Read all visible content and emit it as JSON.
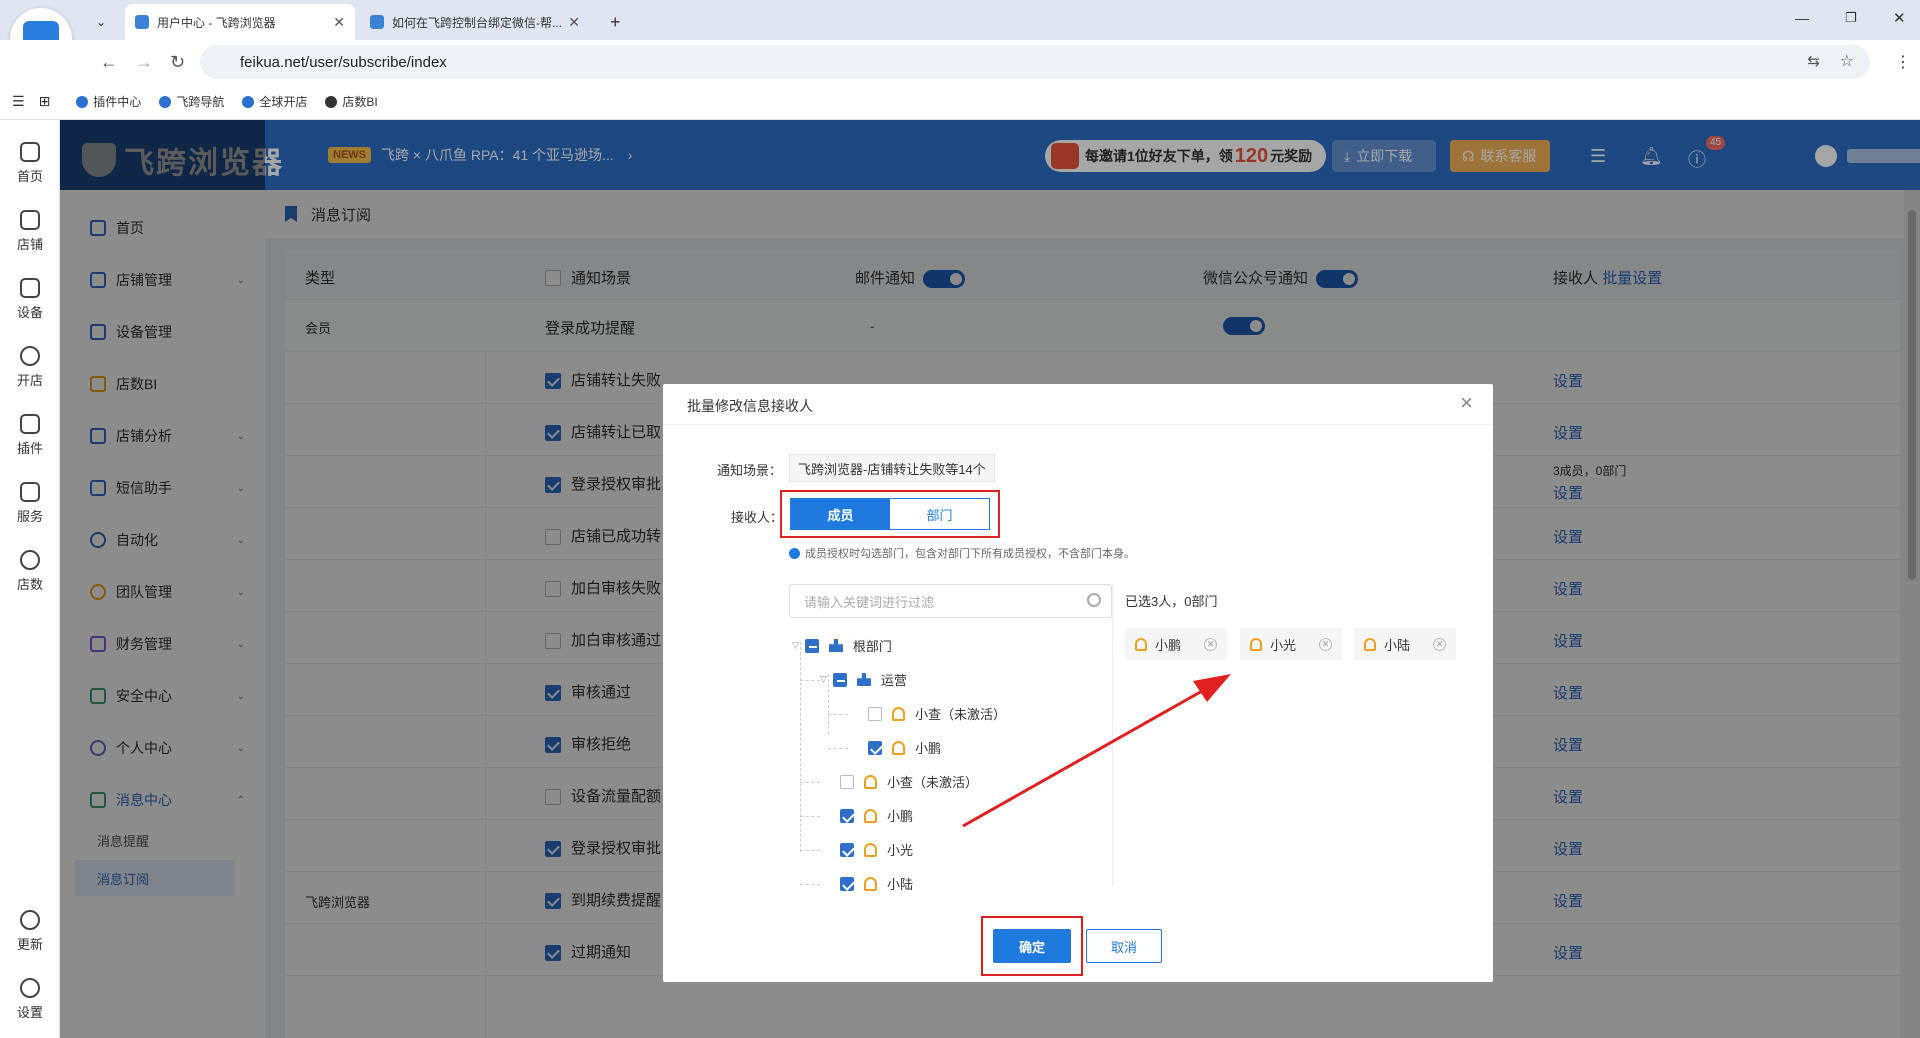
{
  "browser": {
    "tabs": [
      {
        "title": "用户中心 - 飞跨浏览器"
      },
      {
        "title": "如何在飞跨控制台绑定微信-帮..."
      }
    ],
    "url": "feikua.net/user/subscribe/index",
    "bookmarks": [
      "插件中心",
      "飞跨导航",
      "全球开店",
      "店数BI"
    ]
  },
  "left_rail": [
    "首页",
    "店铺",
    "设备",
    "开店",
    "插件",
    "服务",
    "店数",
    "更新",
    "设置"
  ],
  "header": {
    "logo": "飞跨浏览器",
    "news_tag": "NEWS",
    "news_text": "飞跨 × 八爪鱼 RPA：41 个亚马逊场...",
    "invite_pre": "每邀请1位好友下单，领",
    "invite_num": "120",
    "invite_post": "元奖励",
    "download": "立即下载",
    "service": "联系客服",
    "notif_count": "45"
  },
  "sidenav": {
    "items": [
      "首页",
      "店铺管理",
      "设备管理",
      "店数BI",
      "店铺分析",
      "短信助手",
      "自动化",
      "团队管理",
      "财务管理",
      "安全中心",
      "个人中心",
      "消息中心"
    ],
    "sub_items": [
      "消息提醒",
      "消息订阅"
    ]
  },
  "page": {
    "breadcrumb": "消息订阅",
    "columns": {
      "type": "类型",
      "scene": "通知场景",
      "email": "邮件通知",
      "wechat": "微信公众号通知",
      "receiver": "接收人",
      "batch": "批量设置"
    },
    "group_member": "会员",
    "group_browser": "飞跨浏览器",
    "rows": [
      {
        "scene": "登录成功提醒",
        "checked": null,
        "email": "-",
        "action": ""
      },
      {
        "scene": "店铺转让失败",
        "checked": true,
        "action": "设置"
      },
      {
        "scene": "店铺转让已取",
        "checked": true,
        "action": "设置"
      },
      {
        "scene": "登录授权审批",
        "checked": true,
        "action": "设置",
        "extra": "3成员，0部门"
      },
      {
        "scene": "店铺已成功转",
        "checked": false,
        "action": "设置"
      },
      {
        "scene": "加白审核失败",
        "checked": false,
        "action": "设置"
      },
      {
        "scene": "加白审核通过",
        "checked": false,
        "action": "设置"
      },
      {
        "scene": "审核通过",
        "checked": true,
        "action": "设置"
      },
      {
        "scene": "审核拒绝",
        "checked": true,
        "action": "设置"
      },
      {
        "scene": "设备流量配额",
        "checked": false,
        "action": "设置"
      },
      {
        "scene": "登录授权审批",
        "checked": true,
        "action": "设置"
      },
      {
        "scene": "到期续费提醒",
        "checked": true,
        "action": "设置"
      },
      {
        "scene": "过期通知",
        "checked": true,
        "action": "设置",
        "dash": "-"
      }
    ]
  },
  "modal": {
    "title": "批量修改信息接收人",
    "scene_label": "通知场景：",
    "scene_value": "飞跨浏览器-店铺转让失败等14个",
    "receiver_label": "接收人：",
    "seg_member": "成员",
    "seg_dept": "部门",
    "hint": "成员授权时勾选部门，包含对部门下所有成员授权，不含部门本身。",
    "search_placeholder": "请输入关键词进行过滤",
    "tree": {
      "root": "根部门",
      "ops": "运营",
      "ops_members": [
        "小查（未激活）",
        "小鹏"
      ],
      "root_members": [
        "小查（未激活）",
        "小鹏",
        "小光",
        "小陆"
      ]
    },
    "selected_summary": "已选3人，0部门",
    "selected": [
      "小鹏",
      "小光",
      "小陆"
    ],
    "ok": "确定",
    "cancel": "取消"
  },
  "colors": {
    "brand": "#2f6fc8",
    "accent": "#1f7ae0",
    "highlight": "#e02020"
  }
}
